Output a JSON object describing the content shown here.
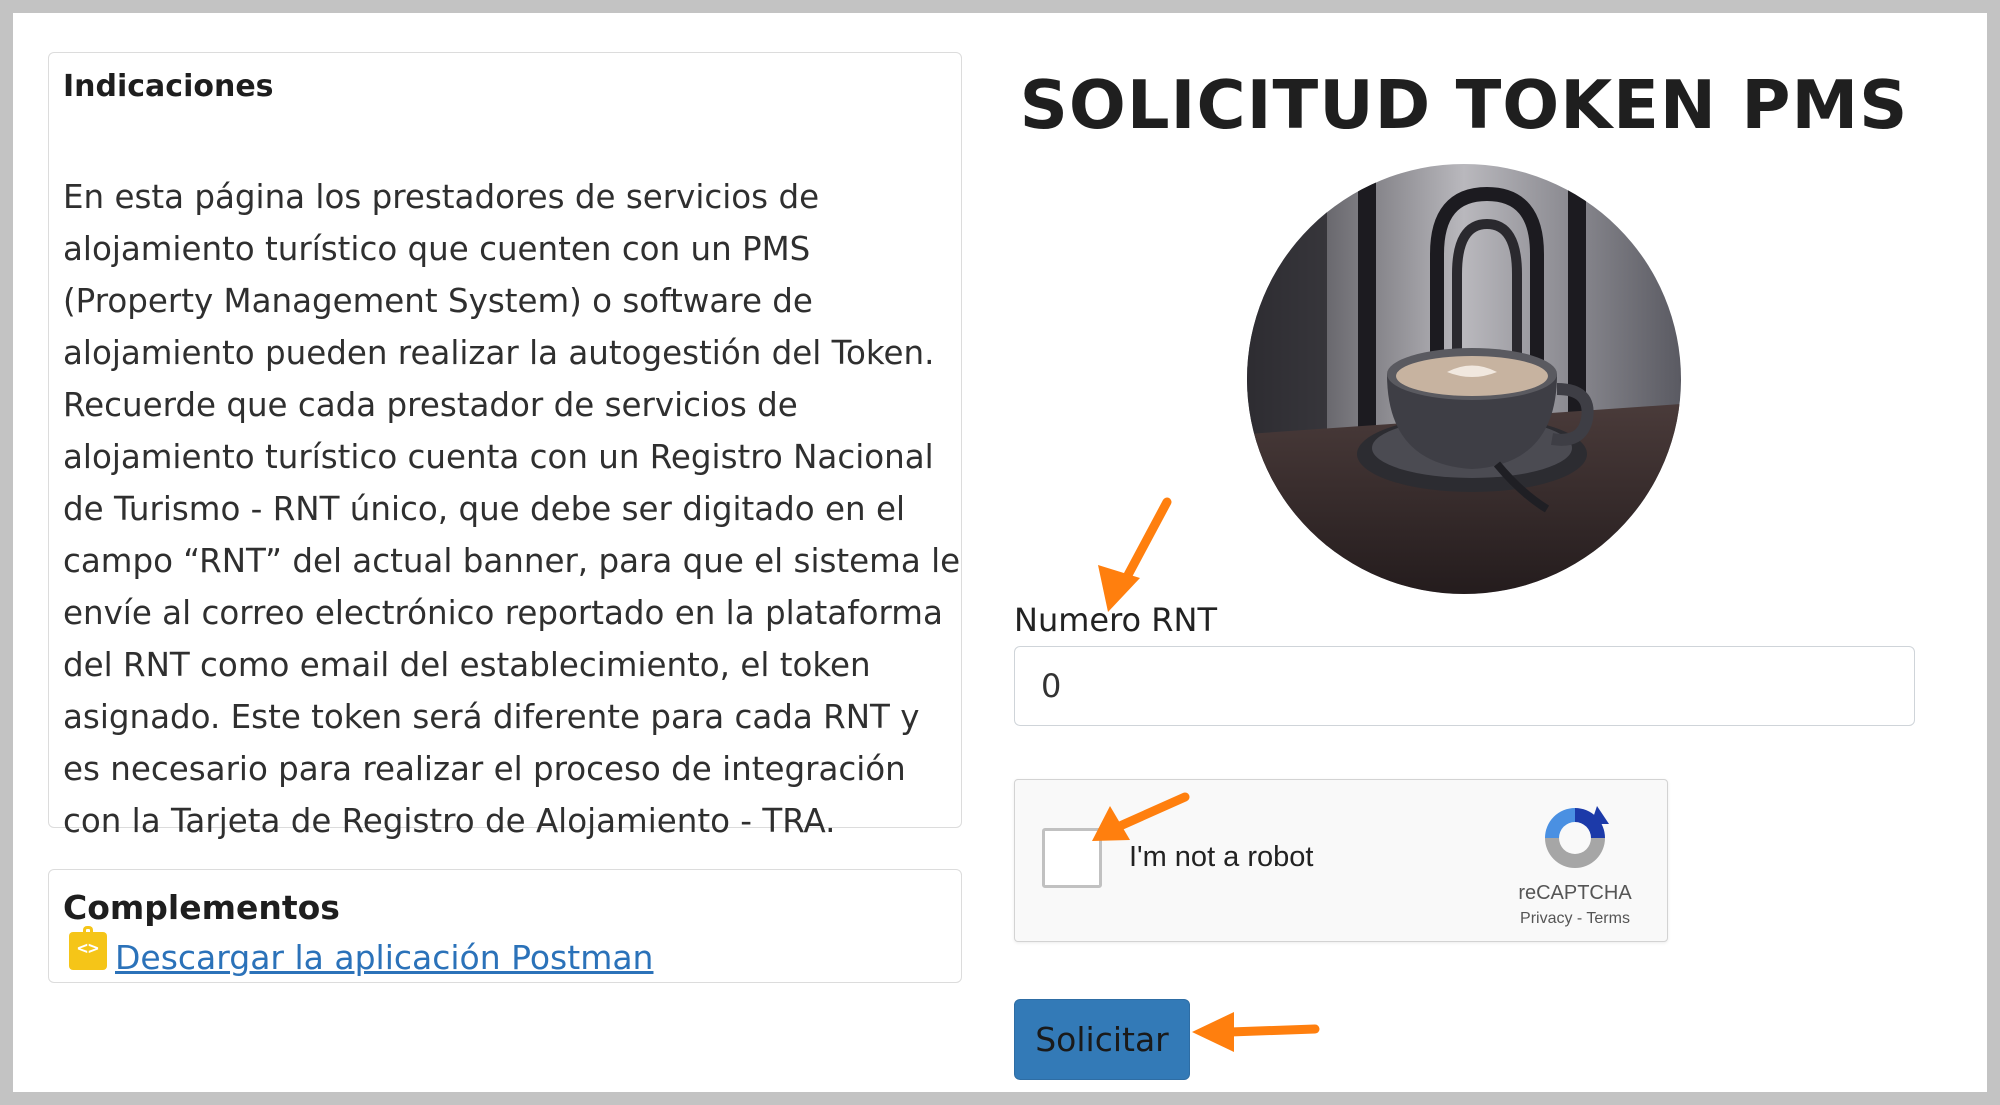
{
  "indicaciones": {
    "title": "Indicaciones",
    "text": "En esta página los prestadores de servicios de alojamiento turístico que cuenten con un PMS (Property Management System) o software de alojamiento pueden realizar la autogestión del Token. Recuerde que cada prestador de servicios de alojamiento turístico cuenta con un Registro Nacional de Turismo - RNT único, que debe ser digitado en el campo “RNT” del actual banner, para que el sistema le envíe al correo electrónico reportado en la plataforma del RNT como email del establecimiento, el token asignado. Este token será diferente para cada RNT y es necesario para realizar el proceso de integración con la Tarjeta de Registro de Alojamiento - TRA."
  },
  "complementos": {
    "title": "Complementos",
    "icon": "postman-icon",
    "link_text": "Descargar la aplicación Postman"
  },
  "form": {
    "title": "SOLICITUD TOKEN PMS",
    "image": "coffee-cup-avatar",
    "rnt_label": "Numero RNT",
    "rnt_value": "0",
    "submit_label": "Solicitar"
  },
  "captcha": {
    "label": "I'm not a robot",
    "brand": "reCAPTCHA",
    "privacy": "Privacy",
    "separator": " - ",
    "terms": "Terms"
  },
  "colors": {
    "accent": "#337ab7",
    "link": "#2b72b9",
    "annotation_arrow": "#ff7f0e",
    "postman_icon": "#f5c518"
  }
}
